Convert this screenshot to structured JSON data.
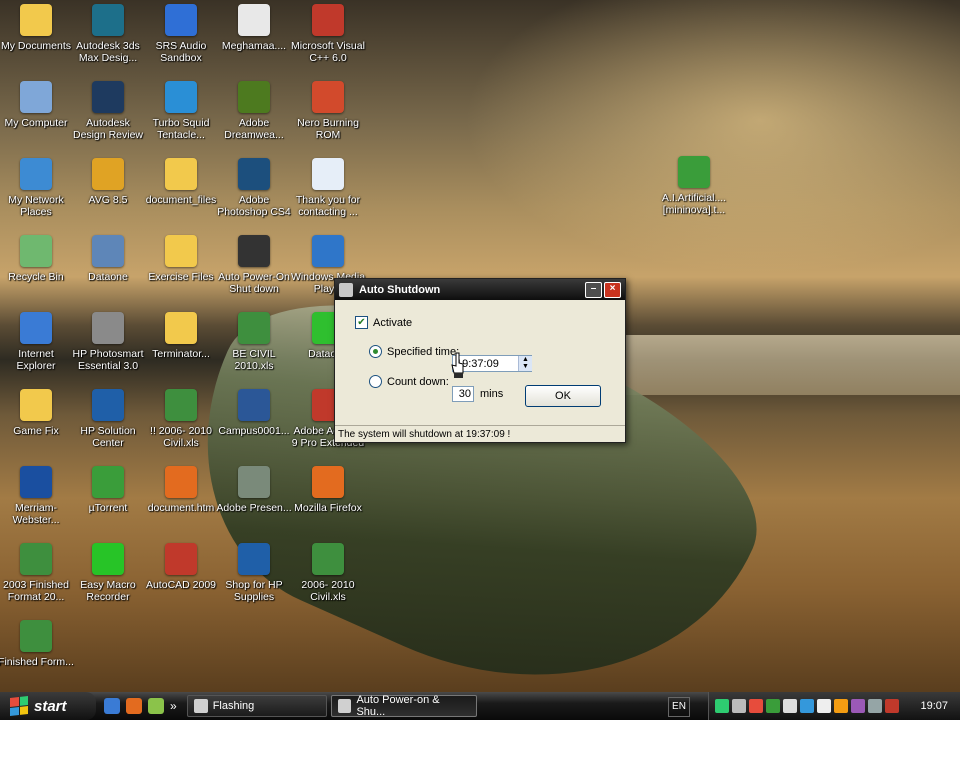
{
  "desktop": {
    "icons": [
      {
        "label": "My Documents",
        "icon": "folder-icon",
        "color": "#f2c94c"
      },
      {
        "label": "Autodesk 3ds Max Desig...",
        "icon": "3dsmax-icon",
        "color": "#1d6f8a"
      },
      {
        "label": "SRS Audio Sandbox",
        "icon": "audio-icon",
        "color": "#2f6fd6"
      },
      {
        "label": "Meghamaa....",
        "icon": "mp3-file-icon",
        "color": "#e8e8e8"
      },
      {
        "label": "Microsoft Visual C++ 6.0",
        "icon": "visual-cpp-icon",
        "color": "#c0392b"
      },
      {
        "label": "My Computer",
        "icon": "computer-icon",
        "color": "#7fa7d8"
      },
      {
        "label": "Autodesk Design Review",
        "icon": "design-review-icon",
        "color": "#1e3a5f"
      },
      {
        "label": "Turbo Squid Tentacle...",
        "icon": "turbosquid-icon",
        "color": "#2a8fd6"
      },
      {
        "label": "Adobe Dreamwea...",
        "icon": "dreamweaver-icon",
        "color": "#4d7a1f"
      },
      {
        "label": "Nero Burning ROM",
        "icon": "nero-icon",
        "color": "#d24a2c"
      },
      {
        "label": "My Network Places",
        "icon": "network-icon",
        "color": "#3d8bd3"
      },
      {
        "label": "AVG 8.5",
        "icon": "avg-icon",
        "color": "#e0a324"
      },
      {
        "label": "document_files",
        "icon": "folder-icon",
        "color": "#f2c94c"
      },
      {
        "label": "Adobe Photoshop CS4",
        "icon": "photoshop-icon",
        "color": "#1c4f7d"
      },
      {
        "label": "Thank you for contacting ...",
        "icon": "document-icon",
        "color": "#e6eef8"
      },
      {
        "label": "Recycle Bin",
        "icon": "recycle-bin-icon",
        "color": "#6fb86f"
      },
      {
        "label": "Dataone",
        "icon": "network-globe-icon",
        "color": "#5e86b8"
      },
      {
        "label": "Exercise Files",
        "icon": "folder-icon",
        "color": "#f2c94c"
      },
      {
        "label": "Auto Power-On Shut down",
        "icon": "power-icon",
        "color": "#333333"
      },
      {
        "label": "Windows Media Play...",
        "icon": "media-player-icon",
        "color": "#2f76c9"
      },
      {
        "label": "Internet Explorer",
        "icon": "ie-icon",
        "color": "#3a7bd5"
      },
      {
        "label": "HP Photosmart Essential 3.0",
        "icon": "hp-photosmart-icon",
        "color": "#8a8a8a"
      },
      {
        "label": "Terminator...",
        "icon": "folder-icon",
        "color": "#f2c94c"
      },
      {
        "label": "BE CIVIL 2010.xls",
        "icon": "excel-icon",
        "color": "#3e8f3e"
      },
      {
        "label": "Dataone",
        "icon": "dataone-icon",
        "color": "#2fbf2f"
      },
      {
        "label": "Game Fix",
        "icon": "folder-icon",
        "color": "#f2c94c"
      },
      {
        "label": "HP Solution Center",
        "icon": "hp-icon",
        "color": "#1f5fa8"
      },
      {
        "label": "!! 2006- 2010 Civil.xls",
        "icon": "excel-icon",
        "color": "#3e8f3e"
      },
      {
        "label": "Campus0001...",
        "icon": "word-icon",
        "color": "#2b5797"
      },
      {
        "label": "Adobe Acrobat 9 Pro Extended",
        "icon": "acrobat-icon",
        "color": "#c0392b"
      },
      {
        "label": "Merriam-Webster...",
        "icon": "merriam-webster-icon",
        "color": "#1a4fa0"
      },
      {
        "label": "µTorrent",
        "icon": "utorrent-icon",
        "color": "#3a9d3a"
      },
      {
        "label": "document.htm",
        "icon": "firefox-doc-icon",
        "color": "#e36b1f"
      },
      {
        "label": "Adobe Presen...",
        "icon": "presenter-icon",
        "color": "#7a8a7a"
      },
      {
        "label": "Mozilla Firefox",
        "icon": "firefox-icon",
        "color": "#e36b1f"
      },
      {
        "label": "2003 Finished Format 20...",
        "icon": "excel-icon",
        "color": "#3e8f3e"
      },
      {
        "label": "Easy Macro Recorder",
        "icon": "macro-recorder-icon",
        "color": "#27c427"
      },
      {
        "label": "AutoCAD 2009",
        "icon": "autocad-icon",
        "color": "#c0392b"
      },
      {
        "label": "Shop for HP Supplies",
        "icon": "hp-shop-icon",
        "color": "#1f5fa8"
      },
      {
        "label": "2006- 2010 Civil.xls",
        "icon": "excel-icon",
        "color": "#3e8f3e"
      },
      {
        "label": "Finished Form...",
        "icon": "excel-icon",
        "color": "#3e8f3e"
      },
      {
        "label": "A.I.Artificial.... [mininova].t...",
        "icon": "utorrent-file-icon",
        "color": "#3a9d3a"
      }
    ]
  },
  "dialog": {
    "title": "Auto Shutdown",
    "activate_label": "Activate",
    "specified_label": "Specified time:",
    "specified_value": "19:37:09",
    "countdown_label": "Count down:",
    "countdown_value": "30",
    "countdown_unit": "mins",
    "ok_label": "OK",
    "status": "The system will shutdown at 19:37:09 !",
    "min_symbol": "–",
    "close_symbol": "×"
  },
  "taskbar": {
    "start_label": "start",
    "chevron": "»",
    "tasks": [
      {
        "label": "Flashing",
        "active": false
      },
      {
        "label": "Auto Power-on & Shu...",
        "active": true
      }
    ],
    "lang": "EN",
    "clock": "19:07"
  }
}
